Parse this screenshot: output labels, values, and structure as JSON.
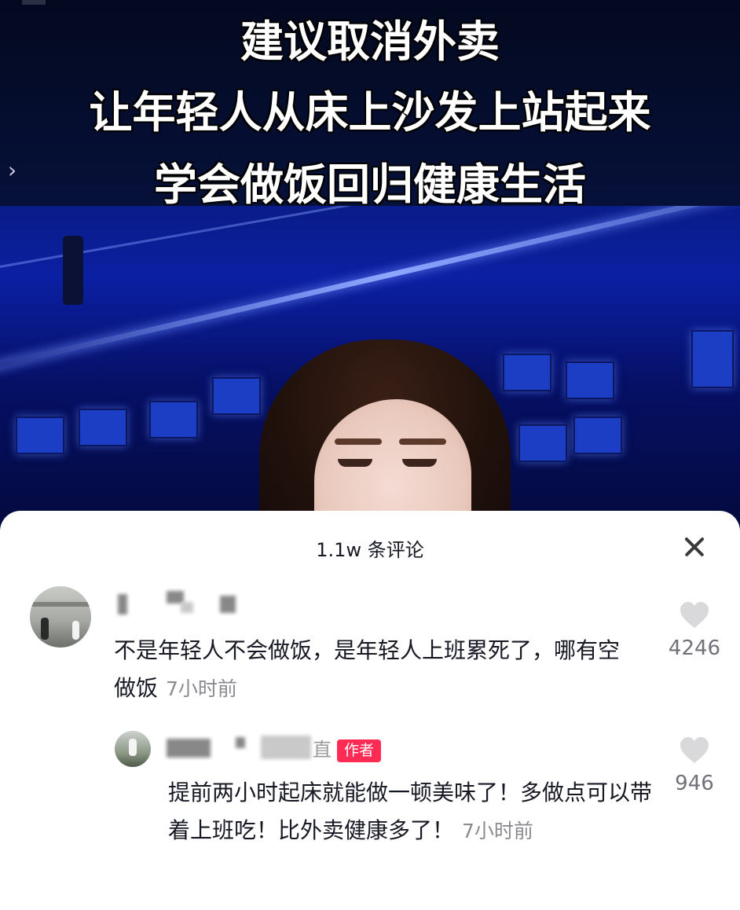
{
  "video": {
    "headline_1": "建议取消外卖",
    "headline_2": "让年轻人从床上沙发上站起来",
    "headline_3": "学会做饭回归健康生活",
    "chevron": "›"
  },
  "comments_panel": {
    "title": "1.1w 条评论",
    "comments": [
      {
        "text": "不是年轻人不会做饭，是年轻人上班累死了，哪有空做饭",
        "time": "7小时前",
        "likes": "4246"
      }
    ],
    "reply": {
      "username_tail": "直",
      "author_badge": "作者",
      "text": "提前两小时起床就能做一顿美味了！多做点可以带着上班吃！比外卖健康多了！",
      "time": "7小时前",
      "likes": "946"
    }
  },
  "colors": {
    "badge": "#fe2c55",
    "heart": "#d9d9db",
    "muted_text": "#8a8b91"
  },
  "icons": [
    "close-icon",
    "heart-icon",
    "chevron-right-icon"
  ]
}
